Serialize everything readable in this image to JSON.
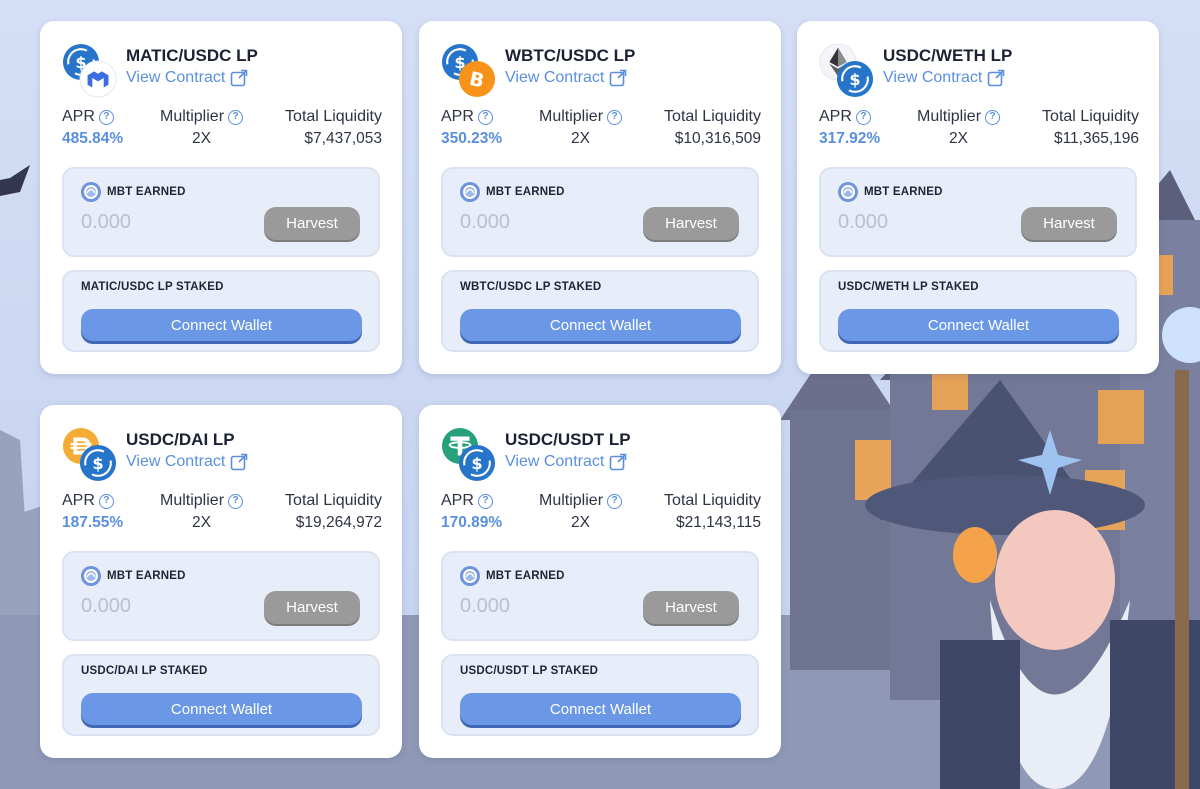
{
  "farms": [
    {
      "pair": "MATIC/USDC LP",
      "tokens": [
        "usdc-icon",
        "matic-icon"
      ],
      "view_contract": "View Contract",
      "apr_label": "APR",
      "apr": "485.84%",
      "multiplier_label": "Multiplier",
      "multiplier": "2X",
      "liquidity_label": "Total Liquidity",
      "liquidity": "$7,437,053",
      "earned_label": "MBT EARNED",
      "earned": "0.000",
      "harvest": "Harvest",
      "staked_label": "MATIC/USDC LP STAKED",
      "connect": "Connect Wallet"
    },
    {
      "pair": "WBTC/USDC LP",
      "tokens": [
        "usdc-icon",
        "bitcoin-icon"
      ],
      "view_contract": "View Contract",
      "apr_label": "APR",
      "apr": "350.23%",
      "multiplier_label": "Multiplier",
      "multiplier": "2X",
      "liquidity_label": "Total Liquidity",
      "liquidity": "$10,316,509",
      "earned_label": "MBT EARNED",
      "earned": "0.000",
      "harvest": "Harvest",
      "staked_label": "WBTC/USDC LP STAKED",
      "connect": "Connect Wallet"
    },
    {
      "pair": "USDC/WETH LP",
      "tokens": [
        "ethereum-icon",
        "usdc-icon"
      ],
      "view_contract": "View Contract",
      "apr_label": "APR",
      "apr": "317.92%",
      "multiplier_label": "Multiplier",
      "multiplier": "2X",
      "liquidity_label": "Total Liquidity",
      "liquidity": "$11,365,196",
      "earned_label": "MBT EARNED",
      "earned": "0.000",
      "harvest": "Harvest",
      "staked_label": "USDC/WETH LP STAKED",
      "connect": "Connect Wallet"
    },
    {
      "pair": "USDC/DAI LP",
      "tokens": [
        "dai-icon",
        "usdc-icon"
      ],
      "view_contract": "View Contract",
      "apr_label": "APR",
      "apr": "187.55%",
      "multiplier_label": "Multiplier",
      "multiplier": "2X",
      "liquidity_label": "Total Liquidity",
      "liquidity": "$19,264,972",
      "earned_label": "MBT EARNED",
      "earned": "0.000",
      "harvest": "Harvest",
      "staked_label": "USDC/DAI LP STAKED",
      "connect": "Connect Wallet"
    },
    {
      "pair": "USDC/USDT LP",
      "tokens": [
        "tether-icon",
        "usdc-icon"
      ],
      "view_contract": "View Contract",
      "apr_label": "APR",
      "apr": "170.89%",
      "multiplier_label": "Multiplier",
      "multiplier": "2X",
      "liquidity_label": "Total Liquidity",
      "liquidity": "$21,143,115",
      "earned_label": "MBT EARNED",
      "earned": "0.000",
      "harvest": "Harvest",
      "staked_label": "USDC/USDT LP STAKED",
      "connect": "Connect Wallet"
    }
  ],
  "colors": {
    "accent": "#5a8fde",
    "connect_button": "#6b98e6",
    "harvest_button": "#9a9a9a",
    "background": "#cfdaf3"
  },
  "background_art": [
    "haunted-house-illustration",
    "wizard-character-illustration",
    "bat-silhouette"
  ]
}
